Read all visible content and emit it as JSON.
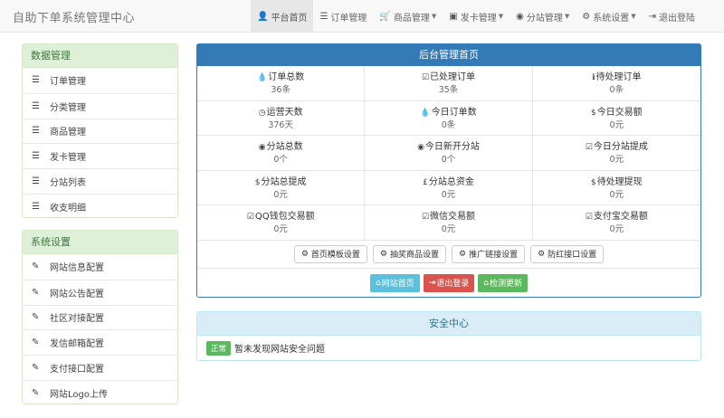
{
  "brand": "自助下单系统管理中心",
  "nav": [
    {
      "icon": "user-icon",
      "glyph": "👤",
      "label": "平台首页",
      "active": true,
      "caret": false
    },
    {
      "icon": "list-icon",
      "glyph": "☰",
      "label": "订单管理",
      "active": false,
      "caret": false
    },
    {
      "icon": "cart-icon",
      "glyph": "🛒",
      "label": "商品管理",
      "active": false,
      "caret": true
    },
    {
      "icon": "card-icon",
      "glyph": "▣",
      "label": "发卡管理",
      "active": false,
      "caret": true
    },
    {
      "icon": "globe-icon",
      "glyph": "◉",
      "label": "分站管理",
      "active": false,
      "caret": true
    },
    {
      "icon": "gear-icon",
      "glyph": "⚙",
      "label": "系统设置",
      "active": false,
      "caret": true
    },
    {
      "icon": "logout-icon",
      "glyph": "⇥",
      "label": "退出登陆",
      "active": false,
      "caret": false
    }
  ],
  "data_panel": {
    "title": "数据管理",
    "items": [
      "订单管理",
      "分类管理",
      "商品管理",
      "发卡管理",
      "分站列表",
      "收支明细"
    ]
  },
  "settings_panel": {
    "title": "系统设置",
    "items": [
      "网站信息配置",
      "网站公告配置",
      "社区对接配置",
      "发信邮箱配置",
      "支付接口配置",
      "网站Logo上传"
    ]
  },
  "main_panel": {
    "title": "后台管理首页",
    "stats": [
      {
        "icon": "drop-icon",
        "glyph": "💧",
        "label": "订单总数",
        "value": "36条"
      },
      {
        "icon": "check-square-icon",
        "glyph": "☑",
        "label": "已处理订单",
        "value": "35条"
      },
      {
        "icon": "info-circle-icon",
        "glyph": "ℹ",
        "label": "待处理订单",
        "value": "0条"
      },
      {
        "icon": "clock-icon",
        "glyph": "◷",
        "label": "运营天数",
        "value": "376天"
      },
      {
        "icon": "drop-icon",
        "glyph": "💧",
        "label": "今日订单数",
        "value": "0条"
      },
      {
        "icon": "dollar-icon",
        "glyph": "$",
        "label": "今日交易额",
        "value": "0元"
      },
      {
        "icon": "globe-icon",
        "glyph": "◉",
        "label": "分站总数",
        "value": "0个"
      },
      {
        "icon": "globe-icon",
        "glyph": "◉",
        "label": "今日新开分站",
        "value": "0个"
      },
      {
        "icon": "check-square-icon",
        "glyph": "☑",
        "label": "今日分站提成",
        "value": "0元"
      },
      {
        "icon": "dollar-icon",
        "glyph": "$",
        "label": "分站总提成",
        "value": "0元"
      },
      {
        "icon": "pound-icon",
        "glyph": "£",
        "label": "分站总资金",
        "value": "0元"
      },
      {
        "icon": "dollar-icon",
        "glyph": "$",
        "label": "待处理提现",
        "value": "0元"
      },
      {
        "icon": "check-square-icon",
        "glyph": "☑",
        "label": "QQ钱包交易额",
        "value": "0元"
      },
      {
        "icon": "check-square-icon",
        "glyph": "☑",
        "label": "微信交易额",
        "value": "0元"
      },
      {
        "icon": "check-square-icon",
        "glyph": "☑",
        "label": "支付宝交易额",
        "value": "0元"
      }
    ],
    "config_buttons": [
      "首页模板设置",
      "抽奖商品设置",
      "推广链接设置",
      "防红接口设置"
    ],
    "site_home": "网站首页",
    "logout": "退出登录",
    "check_update": "检测更新"
  },
  "security": {
    "title": "安全中心",
    "badge": "正常",
    "message": "暂未发现网站安全问题"
  },
  "colors": {
    "primary": "#337ab7",
    "success_bg": "#dff0d8",
    "info_bg": "#d9edf7",
    "btn_info": "#5bc0de",
    "btn_danger": "#d9534f",
    "btn_success": "#5cb85c"
  }
}
